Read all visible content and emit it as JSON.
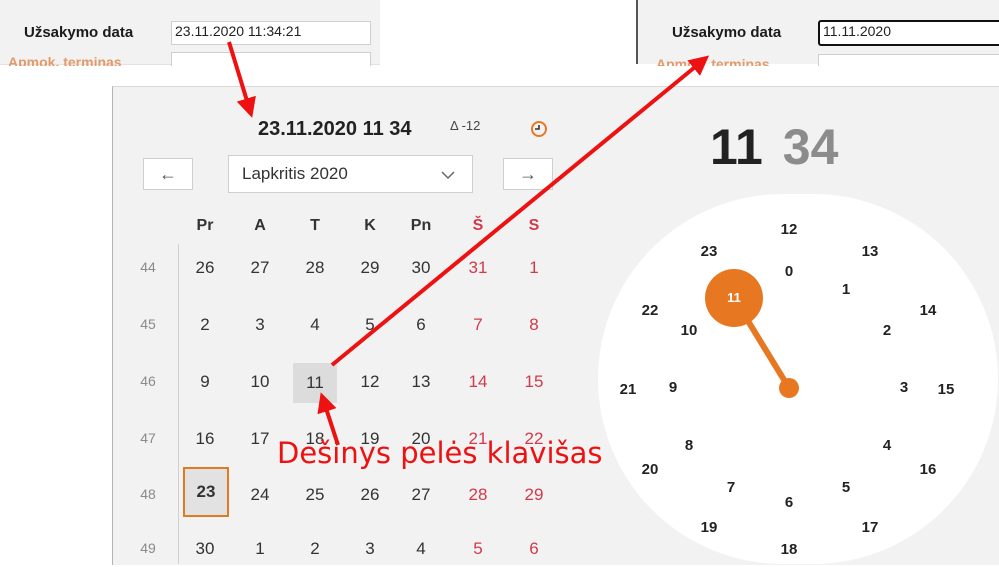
{
  "top_left": {
    "order_date_label": "Užsakymo data",
    "order_date_value": "23.11.2020 11:34:21",
    "term_label": "Apmok. terminas"
  },
  "top_right": {
    "order_date_label": "Užsakymo data",
    "order_date_value": "11.11.2020",
    "term_label": "Apmok. terminas"
  },
  "picker": {
    "header_date": "23.11.2020",
    "header_hour": "11",
    "header_minute": "34",
    "delta": "Δ -12",
    "prev_label": "←",
    "next_label": "→",
    "month_label": "Lapkritis 2020",
    "clock_icon": "clock-icon",
    "big_hour": "11",
    "big_minute": "34",
    "weekdays": [
      "Pr",
      "A",
      "T",
      "K",
      "Pn",
      "Š",
      "S"
    ],
    "weeks": [
      {
        "num": "44",
        "days": [
          "26",
          "27",
          "28",
          "29",
          "30",
          "31",
          "1"
        ]
      },
      {
        "num": "45",
        "days": [
          "2",
          "3",
          "4",
          "5",
          "6",
          "7",
          "8"
        ]
      },
      {
        "num": "46",
        "days": [
          "9",
          "10",
          "11",
          "12",
          "13",
          "14",
          "15"
        ]
      },
      {
        "num": "47",
        "days": [
          "16",
          "17",
          "18",
          "19",
          "20",
          "21",
          "22"
        ]
      },
      {
        "num": "48",
        "days": [
          "23",
          "24",
          "25",
          "26",
          "27",
          "28",
          "29"
        ]
      },
      {
        "num": "49",
        "days": [
          "30",
          "1",
          "2",
          "3",
          "4",
          "5",
          "6"
        ]
      }
    ],
    "highlighted_day": "11",
    "selected_day": "23",
    "clock_selected_hour": "11",
    "clock_outer": [
      "12",
      "13",
      "14",
      "15",
      "16",
      "17",
      "18",
      "19",
      "20",
      "21",
      "22",
      "23"
    ],
    "clock_inner": [
      "0",
      "1",
      "2",
      "3",
      "4",
      "5",
      "6",
      "7",
      "8",
      "9",
      "10"
    ]
  },
  "annotation": "Dešinys pelės klavišas",
  "colors": {
    "accent": "#e87722",
    "arrow": "#ee1111",
    "weekend": "#d2394a",
    "minute_gray": "#8c8c8c"
  }
}
